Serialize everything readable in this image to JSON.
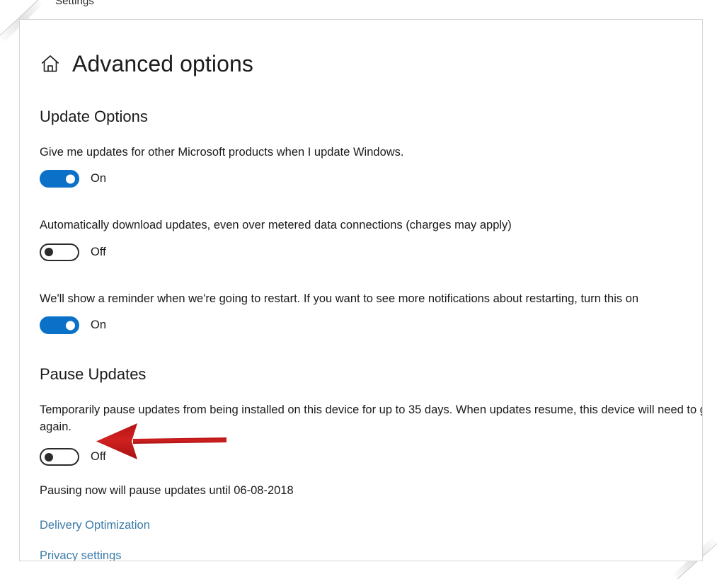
{
  "window": {
    "chrome_title": "Settings",
    "home_icon": "home-icon",
    "page_title": "Advanced options"
  },
  "sections": [
    {
      "id": "update-options",
      "heading": "Update Options",
      "settings": [
        {
          "id": "give-me-updates",
          "description": "Give me updates for other Microsoft products when I update Windows.",
          "toggle_state": "on",
          "toggle_label": "On"
        },
        {
          "id": "auto-download-metered",
          "description": "Automatically download updates, even over metered data connections (charges may apply)",
          "toggle_state": "off",
          "toggle_label": "Off"
        },
        {
          "id": "restart-reminder",
          "description": "We'll show a reminder when we're going to restart. If you want to see more notifications about restarting, turn this on",
          "toggle_state": "on",
          "toggle_label": "On"
        }
      ]
    },
    {
      "id": "pause-updates",
      "heading": "Pause Updates",
      "settings": [
        {
          "id": "pause-updates-toggle",
          "description": "Temporarily pause updates from being installed on this device for up to 35 days. When updates resume, this device will need to get the latest updates before it can be paused again.",
          "toggle_state": "off",
          "toggle_label": "Off"
        }
      ],
      "note": "Pausing now will pause updates until 06-08-2018"
    }
  ],
  "links": [
    {
      "id": "delivery-optimization",
      "label": "Delivery Optimization"
    },
    {
      "id": "privacy-settings",
      "label": "Privacy settings"
    }
  ],
  "annotation": {
    "type": "arrow",
    "direction": "left",
    "points_at": "pause-updates-toggle",
    "color": "#c01818"
  },
  "colors": {
    "accent_blue": "#0a70c8",
    "link_blue": "#3b7ba8",
    "text": "#1a1a1a",
    "toggle_off_border": "#2b2b2b",
    "window_border": "#d6d6d6",
    "annotation_red": "#c01818"
  }
}
